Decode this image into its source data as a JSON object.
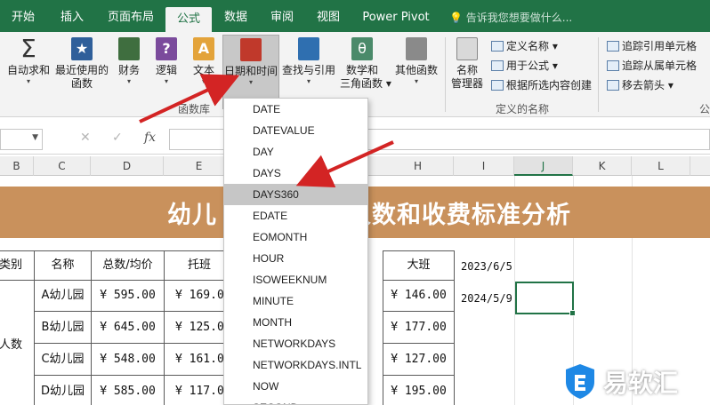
{
  "tabs": [
    "开始",
    "插入",
    "页面布局",
    "公式",
    "数据",
    "审阅",
    "视图",
    "Power Pivot"
  ],
  "active_tab": "公式",
  "tell_me": "告诉我您想要做什么...",
  "ribbon": {
    "autosum": "自动求和",
    "recent": "最近使用的",
    "recent2": "函数",
    "financial": "财务",
    "logical": "逻辑",
    "text": "文本",
    "datetime": "日期和时间",
    "lookup": "查找与引用",
    "math": "数学和",
    "math2": "三角函数",
    "more": "其他函数",
    "group_library": "函数库",
    "name_mgr": "名称",
    "name_mgr2": "管理器",
    "define_name": "定义名称",
    "use_in_formula": "用于公式",
    "create_from_sel": "根据所选内容创建",
    "group_defined": "定义的名称",
    "trace_prec": "追踪引用单元格",
    "trace_dep": "追踪从属单元格",
    "remove_arrows": "移去箭头",
    "cut_label": "公"
  },
  "formula_bar": {
    "cancel": "✕",
    "enter": "✓",
    "fx": "fx"
  },
  "columns": [
    "B",
    "C",
    "D",
    "E",
    "H",
    "I",
    "J",
    "K",
    "L"
  ],
  "selected_column": "J",
  "sheet": {
    "title_left": "幼儿",
    "title_right": "在园人数和收费标准分析",
    "headers": {
      "category": "类别",
      "name": "名称",
      "total": "总数/均价",
      "tuoban": "托班",
      "daban": "大班"
    },
    "rows": [
      {
        "name": "A幼儿园",
        "total": "¥  595.00",
        "tuoban": "¥  169.0",
        "daban": "¥  146.00"
      },
      {
        "name": "B幼儿园",
        "total": "¥  645.00",
        "tuoban": "¥  125.0",
        "daban": "¥  177.00"
      },
      {
        "name": "C幼儿园",
        "total": "¥  548.00",
        "tuoban": "¥  161.0",
        "daban": "¥  127.00"
      },
      {
        "name": "D幼儿园",
        "total": "¥  585.00",
        "tuoban": "¥  117.0",
        "daban": "¥  195.00"
      }
    ],
    "category_value": "人数",
    "date1": "2023/6/5",
    "date2": "2024/5/9"
  },
  "dropdown_items": [
    "DATE",
    "DATEVALUE",
    "DAY",
    "DAYS",
    "DAYS360",
    "EDATE",
    "EOMONTH",
    "HOUR",
    "ISOWEEKNUM",
    "MINUTE",
    "MONTH",
    "NETWORKDAYS",
    "NETWORKDAYS.INTL",
    "NOW",
    "SECOND"
  ],
  "dropdown_highlight": "DAYS360",
  "watermark": "易软汇",
  "colors": {
    "excel_green": "#217346",
    "title_band": "#c9915c",
    "arrow_red": "#d32424"
  }
}
